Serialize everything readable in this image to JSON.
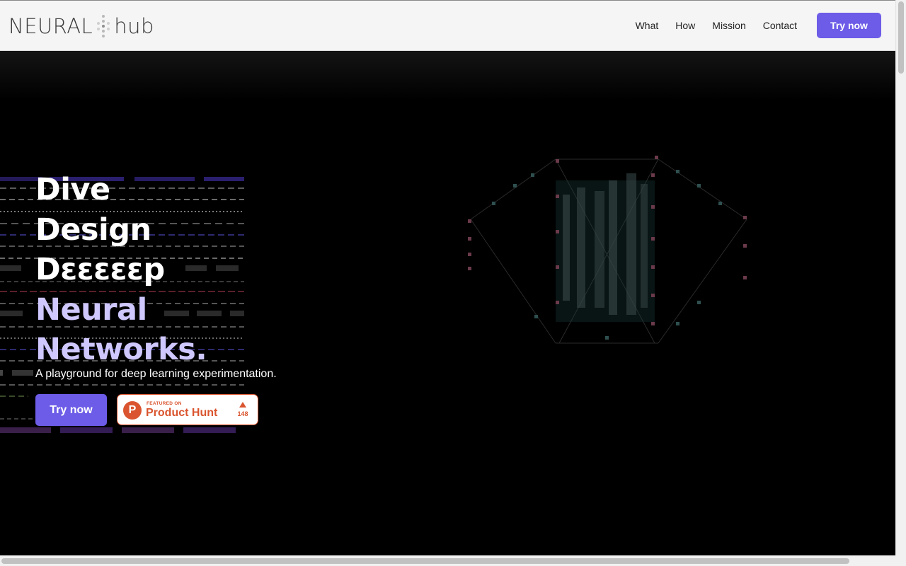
{
  "brand": {
    "logo_left": "NEURAL",
    "logo_right": "hub"
  },
  "nav": {
    "items": [
      {
        "label": "What"
      },
      {
        "label": "How"
      },
      {
        "label": "Mission"
      },
      {
        "label": "Contact"
      }
    ],
    "cta_label": "Try now"
  },
  "hero": {
    "headline": [
      "Dive",
      "Design",
      "Dεεεεεp",
      "Neural",
      "Networks."
    ],
    "tagline": "A playground for deep learning experimentation.",
    "cta_label": "Try now",
    "product_hunt": {
      "featured_label": "FEATURED ON",
      "name": "Product Hunt",
      "logo_letter": "P",
      "upvotes": "148"
    }
  },
  "colors": {
    "accent": "#6c5ce7",
    "headline_accent": "#cfc8ff",
    "product_hunt": "#da552f"
  },
  "icons": {
    "logo_mark": "neural-dots-icon",
    "upvote": "triangle-up-icon"
  }
}
